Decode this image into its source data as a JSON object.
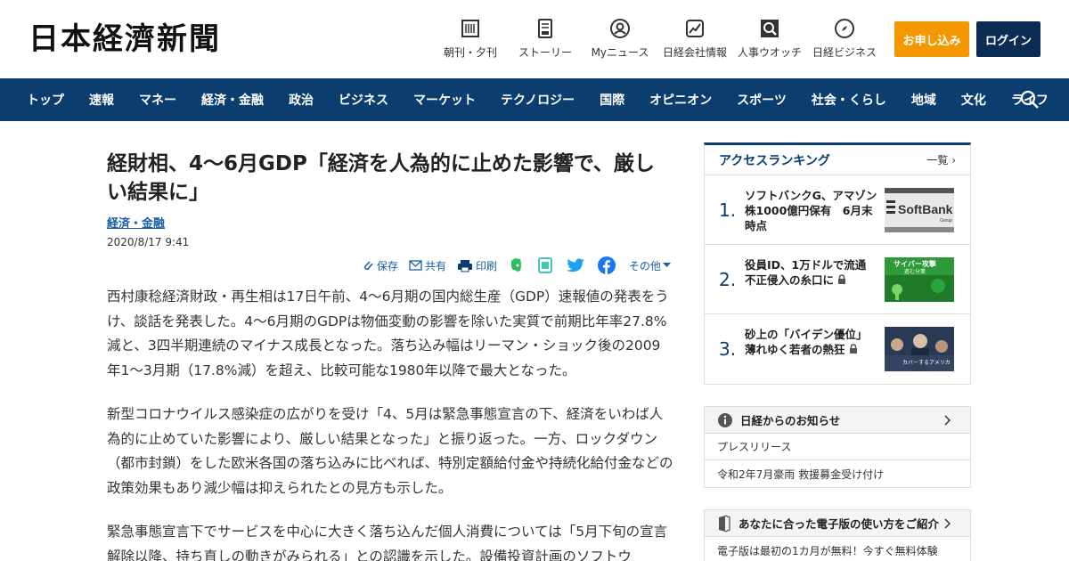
{
  "header": {
    "logo": "日本経濟新聞",
    "utility_nav": [
      {
        "label": "朝刊・夕刊",
        "icon": "newspaper-icon"
      },
      {
        "label": "ストーリー",
        "icon": "story-icon"
      },
      {
        "label": "Myニュース",
        "icon": "user-icon"
      },
      {
        "label": "日経会社情報",
        "icon": "chart-icon"
      },
      {
        "label": "人事ウオッチ",
        "icon": "search-person-icon"
      },
      {
        "label": "日経ビジネス",
        "icon": "compass-icon"
      }
    ],
    "apply_label": "お申し込み",
    "login_label": "ログイン",
    "colors": {
      "apply": "#f39800",
      "login": "#0b2d55",
      "nav": "#0b3d6e"
    }
  },
  "nav": {
    "items": [
      "トップ",
      "速報",
      "マネー",
      "経済・金融",
      "政治",
      "ビジネス",
      "マーケット",
      "テクノロジー",
      "国際",
      "オピニオン",
      "スポーツ",
      "社会・くらし",
      "地域",
      "文化",
      "ライフ"
    ]
  },
  "article": {
    "headline": "経財相、4～6月GDP「経済を人為的に止めた影響で、厳しい結果に」",
    "category": "経済・金融",
    "date": "2020/8/17 9:41",
    "tools": {
      "save": "保存",
      "share": "共有",
      "print": "印刷",
      "more": "その他"
    },
    "paragraphs": [
      "西村康稔経済財政・再生相は17日午前、4～6月期の国内総生産（GDP）速報値の発表をうけ、談話を発表した。4～6月期のGDPは物価変動の影響を除いた実質で前期比年率27.8%減と、3四半期連続のマイナス成長となった。落ち込み幅はリーマン・ショック後の2009年1～3月期（17.8%減）を超え、比較可能な1980年以降で最大となった。",
      "新型コロナウイルス感染症の広がりを受け「4、5月は緊急事態宣言の下、経済をいわば人為的に止めていた影響により、厳しい結果となった」と振り返った。一方、ロックダウン（都市封鎖）をした欧米各国の落ち込みに比べれば、特別定額給付金や持続化給付金などの政策効果もあり減少幅は抑えられたとの見方も示した。",
      "緊急事態宣言下でサービスを中心に大きく落ち込んだ個人消費については「5月下旬の宣言解除以降、持ち直しの動きがみられる」との認識を示した。設備投資計画のソフトウ"
    ]
  },
  "ranking": {
    "title": "アクセスランキング",
    "more": "一覧",
    "items": [
      {
        "rank": "1.",
        "title": "ソフトバンクG、アマゾン株1000億円保有　6月末時点",
        "thumb_text": "SoftBank",
        "thumb_sub": "Group"
      },
      {
        "rank": "2.",
        "title": "役員ID、1万ドルで流通　不正侵入の糸口に",
        "thumb_text": "サイバー攻撃",
        "thumb_sub": "進む分業"
      },
      {
        "rank": "3.",
        "title": "砂上の「バイデン優位」　薄れゆく若者の熱狂",
        "thumb_text": "カバーするアメリカ",
        "thumb_sub": ""
      }
    ]
  },
  "notice": {
    "title": "日経からのお知らせ",
    "rows": [
      "プレスリリース",
      "令和2年7月豪雨 救援募金受け付け"
    ]
  },
  "guide": {
    "title": "あなたに合った電子版の使い方をご紹介",
    "rows": [
      "電子版は最初の1カ月が無料！今すぐ無料体験"
    ]
  }
}
